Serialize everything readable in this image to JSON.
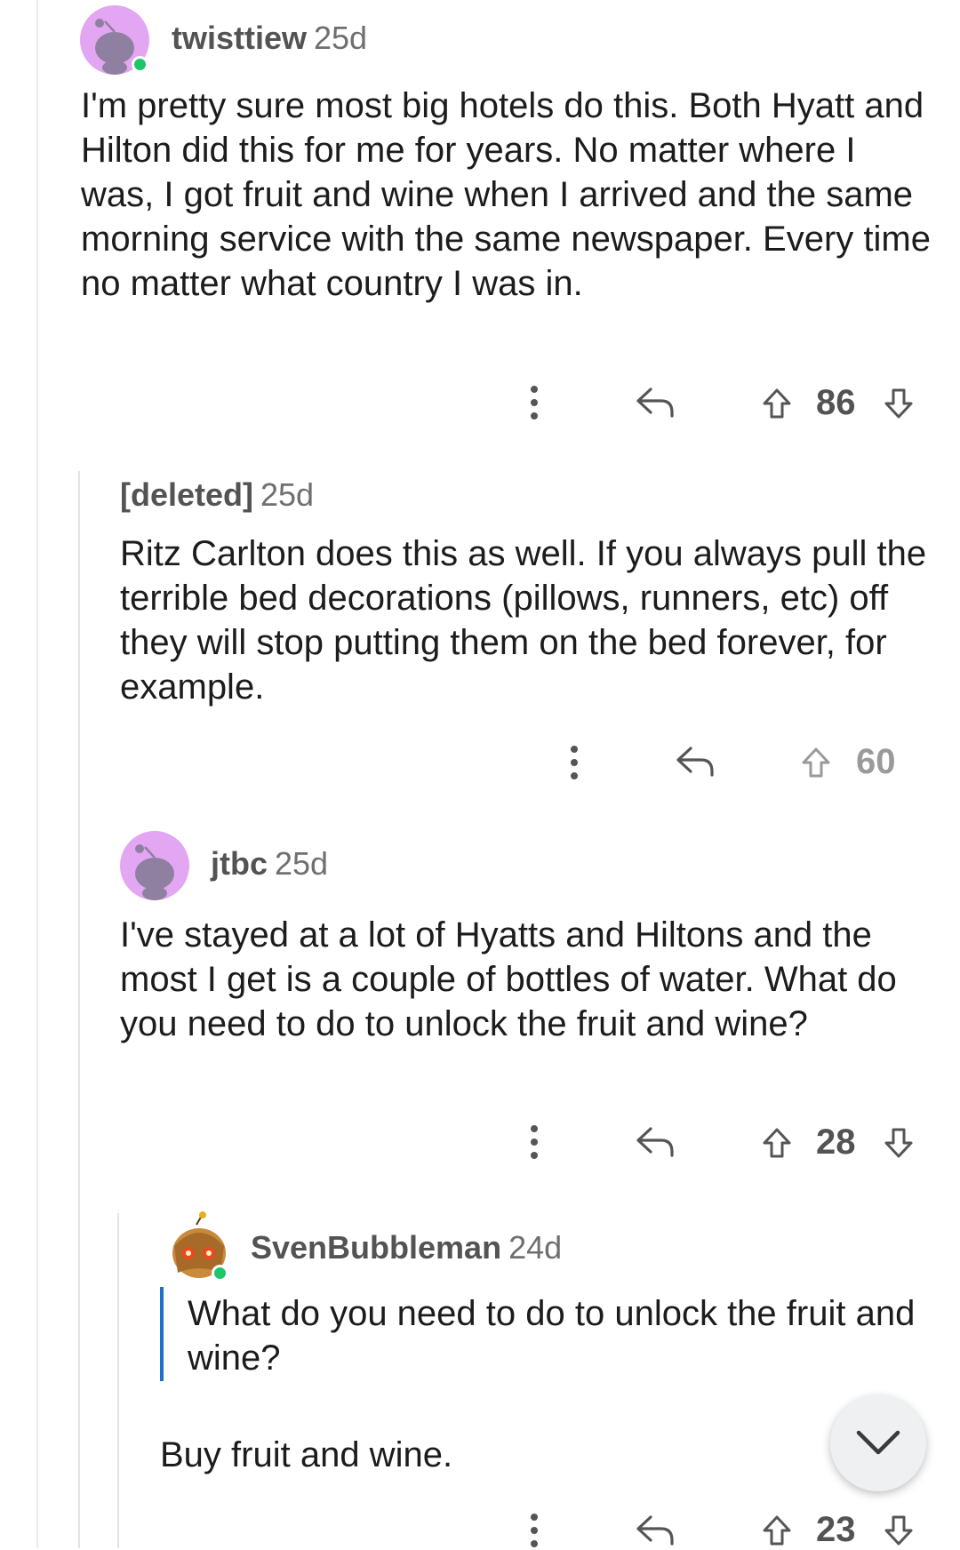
{
  "comments": [
    {
      "username": "twisttiew",
      "age": "25d",
      "body": "I'm pretty sure most big hotels do this. Both Hyatt and Hilton did this for me for years. No matter where I was, I got fruit and wine when I arrived and the same morning service with the same newspaper. Every time no matter what country I was in.",
      "score": "86"
    },
    {
      "username": "[deleted]",
      "age": "25d",
      "body": "Ritz Carlton does this as well. If you always pull the terrible bed decorations (pillows, runners, etc) off they will stop putting them on the bed forever, for example.",
      "score": "60"
    },
    {
      "username": "jtbc",
      "age": "25d",
      "body": "I've stayed at a lot of Hyatts and Hiltons and the most I get is a couple of bottles of water. What do you need to do to unlock the fruit and wine?",
      "score": "28"
    },
    {
      "username": "SvenBubbleman",
      "age": "24d",
      "quote": "What do you need to do to unlock the fruit and wine?",
      "body": "Buy fruit and wine.",
      "score": "23"
    }
  ],
  "icons": {
    "more": "more-options-icon",
    "reply": "reply-icon",
    "upvote": "upvote-icon",
    "downvote": "downvote-icon",
    "scroll": "chevron-down-icon"
  },
  "colors": {
    "online": "#20c46a",
    "quote_bar": "#1f70c9",
    "avatar_bg": "#e2a6f3",
    "avatar_snoo": "#8f7fa0"
  }
}
